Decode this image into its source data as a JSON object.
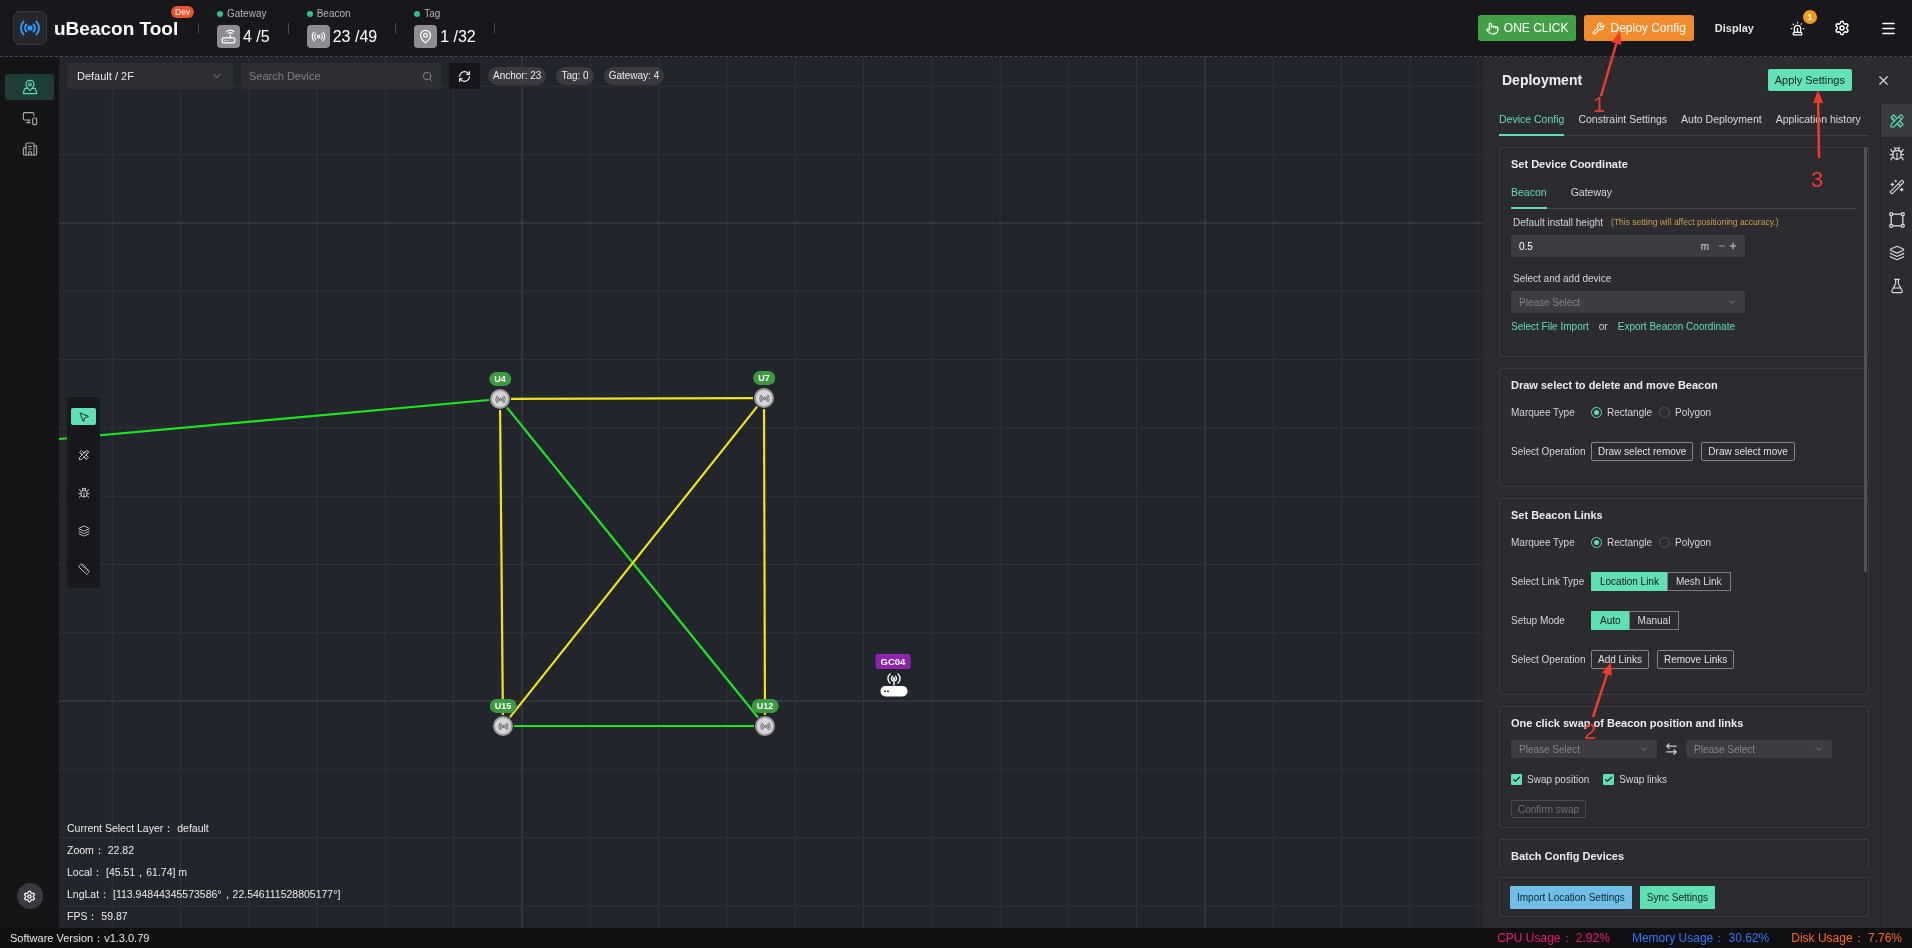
{
  "header": {
    "app_name": "uBeacon Tool",
    "badge": "Dev",
    "stats": [
      {
        "kind": "gateway",
        "label": "Gateway",
        "value": "4 /5"
      },
      {
        "kind": "beacon",
        "label": "Beacon",
        "value": "23 /49"
      },
      {
        "kind": "tag",
        "label": "Tag",
        "value": "1 /32"
      }
    ],
    "actions": [
      {
        "kind": "one_click",
        "label": "ONE CLICK"
      },
      {
        "kind": "deploy",
        "label": "Deploy Config"
      },
      {
        "kind": "text",
        "label": "Display"
      }
    ],
    "alarm_count": "1"
  },
  "sidebar": {
    "items": [
      {
        "kind": "map",
        "selected": true
      },
      {
        "kind": "devices",
        "selected": false
      },
      {
        "kind": "building",
        "selected": false
      }
    ]
  },
  "map": {
    "floor": "Default / 2F",
    "search_placeholder": "Search Device",
    "counts": [
      "Anchor: 23",
      "Tag: 0",
      "Gateway: 4"
    ],
    "tools": [
      {
        "kind": "pointer",
        "selected": true
      },
      {
        "kind": "tools",
        "selected": false
      },
      {
        "kind": "bug",
        "selected": false
      },
      {
        "kind": "layers",
        "selected": false
      },
      {
        "kind": "ruler",
        "selected": false
      }
    ],
    "beacons": [
      {
        "label": "U4"
      },
      {
        "label": "U7"
      },
      {
        "label": "U15"
      },
      {
        "label": "U12"
      }
    ],
    "gateways": [
      {
        "label": "GC04"
      }
    ],
    "links": [
      {
        "color": "#1ee61e"
      },
      {
        "color": "#f2e21a"
      },
      {
        "color": "#f2e21a"
      },
      {
        "color": "#1ee61e"
      },
      {
        "color": "#f2e21a"
      },
      {
        "color": "#f2e21a"
      },
      {
        "color": "#1ee61e"
      }
    ],
    "info": [
      "Current Select Layer： default",
      "Zoom： 22.82",
      "Local： [45.51，61.74] m",
      "LngLat： [113.94844345573586°，22.546111528805177°]",
      "FPS： 59.87"
    ]
  },
  "panel": {
    "title": "Deployment",
    "apply": "Apply Settings",
    "tabs": [
      {
        "label": "Device Config",
        "selected": true
      },
      {
        "label": "Constraint Settings",
        "selected": false
      },
      {
        "label": "Auto Deployment",
        "selected": false
      },
      {
        "label": "Application history",
        "selected": false
      }
    ],
    "rail": [
      {
        "kind": "tools",
        "selected": true
      },
      {
        "kind": "bug",
        "selected": false
      },
      {
        "kind": "wand",
        "selected": false
      },
      {
        "kind": "shape",
        "selected": false
      },
      {
        "kind": "layers",
        "selected": false
      },
      {
        "kind": "flask",
        "selected": false
      }
    ],
    "sections": [
      {
        "kind": "coordinate",
        "title": "Set Device Coordinate",
        "subtabs": [
          {
            "label": "Beacon",
            "selected": true
          },
          {
            "label": "Gateway",
            "selected": false
          }
        ],
        "height_label": "Default install height",
        "height_note": "(This setting will affect positioning accuracy.)",
        "height_value": "0.5",
        "height_unit": "m",
        "device_label": "Select and add device",
        "device_placeholder": "Please Select",
        "import_link": "Select File Import",
        "separator": "or",
        "export_link": "Export Beacon Coordinate"
      },
      {
        "kind": "form",
        "title": "Draw select to delete and move Beacon",
        "rows": [
          {
            "kind": "radio",
            "label": "Marquee Type",
            "options": [
              {
                "label": "Rectangle",
                "selected": true
              },
              {
                "label": "Polygon",
                "selected": false
              }
            ]
          },
          {
            "kind": "buttons",
            "label": "Select Operation",
            "options": [
              {
                "label": "Draw select remove"
              },
              {
                "label": "Draw select move"
              }
            ]
          }
        ]
      },
      {
        "kind": "form",
        "title": "Set Beacon Links",
        "rows": [
          {
            "kind": "radio",
            "label": "Marquee Type",
            "options": [
              {
                "label": "Rectangle",
                "selected": true
              },
              {
                "label": "Polygon",
                "selected": false
              }
            ]
          },
          {
            "kind": "segmented",
            "label": "Select Link Type",
            "options": [
              {
                "label": "Location Link",
                "selected": true
              },
              {
                "label": "Mesh Link",
                "selected": false
              }
            ]
          },
          {
            "kind": "segmented",
            "label": "Setup Mode",
            "options": [
              {
                "label": "Auto",
                "selected": true
              },
              {
                "label": "Manual",
                "selected": false
              }
            ]
          },
          {
            "kind": "buttons",
            "label": "Select Operation",
            "options": [
              {
                "label": "Add Links"
              },
              {
                "label": "Remove Links"
              }
            ]
          }
        ]
      },
      {
        "kind": "swap",
        "title": "One click swap of Beacon position and links",
        "selects": [
          {
            "placeholder": "Please Select"
          },
          {
            "placeholder": "Please Select"
          }
        ],
        "checks": [
          {
            "label": "Swap position",
            "checked": true
          },
          {
            "label": "Swap links",
            "checked": true
          }
        ],
        "confirm": {
          "label": "Confirm swap",
          "disabled": true
        }
      },
      {
        "kind": "title",
        "title": "Batch Config Devices"
      }
    ],
    "footer_buttons": [
      {
        "kind": "info",
        "label": "Import Location Settings"
      },
      {
        "kind": "primary",
        "label": "Sync Settings"
      }
    ]
  },
  "status_bar": {
    "version": "Software Version：v1.3.0.79",
    "usage": [
      {
        "label": "CPU Usage： 2.92%",
        "color": "#f0186c"
      },
      {
        "label": "Memory Usage： 30.62%",
        "color": "#2b7bff"
      },
      {
        "label": "Disk Usage： 7.76%",
        "color": "#ff6a1a"
      }
    ]
  },
  "annotations": [
    {
      "label": "1"
    },
    {
      "label": "2"
    },
    {
      "label": "3"
    }
  ]
}
